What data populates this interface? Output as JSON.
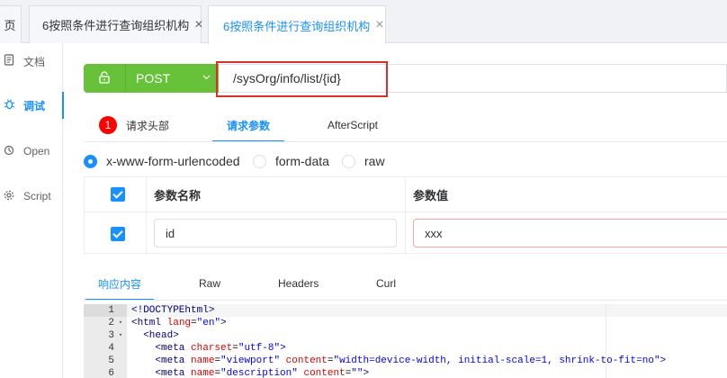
{
  "tabs": [
    {
      "label": "页"
    },
    {
      "label": "6按照条件进行查询组织机构",
      "close": "×"
    },
    {
      "label": "6按照条件进行查询组织机构",
      "close": "×",
      "active": true
    }
  ],
  "sidebar": {
    "items": [
      {
        "icon": "document-icon",
        "label": "文档"
      },
      {
        "icon": "bug-icon",
        "label": "调试",
        "active": true
      },
      {
        "icon": "open-icon",
        "label": "Open"
      },
      {
        "icon": "script-icon",
        "label": "Script"
      }
    ]
  },
  "request": {
    "method": "POST",
    "url": "/sysOrg/info/list/{id}"
  },
  "request_tabs": [
    {
      "label": "请求头部",
      "badge": "1"
    },
    {
      "label": "请求参数",
      "active": true
    },
    {
      "label": "AfterScript"
    }
  ],
  "body_types": [
    {
      "label": "x-www-form-urlencoded",
      "checked": true
    },
    {
      "label": "form-data",
      "checked": false
    },
    {
      "label": "raw",
      "checked": false
    }
  ],
  "params_table": {
    "headers": [
      "参数名称",
      "参数值"
    ],
    "rows": [
      {
        "checked": true,
        "name": "id",
        "value": "xxx"
      }
    ]
  },
  "response_tabs": [
    {
      "label": "响应内容",
      "active": true
    },
    {
      "label": "Raw"
    },
    {
      "label": "Headers"
    },
    {
      "label": "Curl"
    }
  ],
  "code": {
    "lines": [
      {
        "n": "1",
        "fold": "",
        "text": "<!DOCTYPE html>"
      },
      {
        "n": "2",
        "fold": "▾",
        "text": "<html lang=\"en\">"
      },
      {
        "n": "3",
        "fold": "▾",
        "text": "  <head>"
      },
      {
        "n": "4",
        "fold": "",
        "text": "    <meta charset=\"utf-8\">"
      },
      {
        "n": "5",
        "fold": "",
        "text": "    <meta name=\"viewport\" content=\"width=device-width, initial-scale=1, shrink-to-fit=no\">"
      },
      {
        "n": "6",
        "fold": "",
        "text": "    <meta name=\"description\" content=\"\">"
      }
    ]
  },
  "colors": {
    "accent": "#1890ff",
    "method_green": "#67c23a",
    "highlight_red": "#d9302c"
  }
}
